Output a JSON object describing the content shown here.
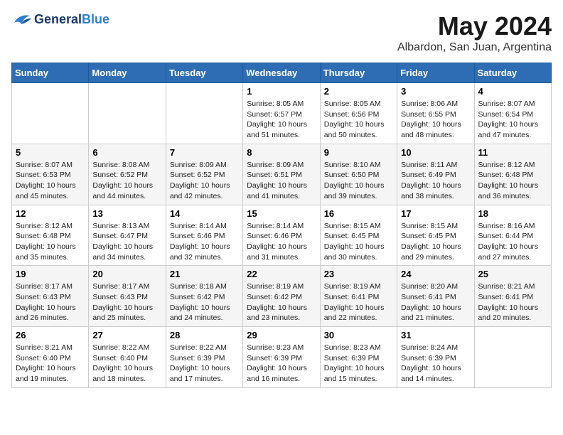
{
  "header": {
    "logo_line1": "General",
    "logo_line2": "Blue",
    "month_title": "May 2024",
    "location": "Albardon, San Juan, Argentina"
  },
  "weekdays": [
    "Sunday",
    "Monday",
    "Tuesday",
    "Wednesday",
    "Thursday",
    "Friday",
    "Saturday"
  ],
  "weeks": [
    [
      {
        "day": "",
        "sunrise": "",
        "sunset": "",
        "daylight": ""
      },
      {
        "day": "",
        "sunrise": "",
        "sunset": "",
        "daylight": ""
      },
      {
        "day": "",
        "sunrise": "",
        "sunset": "",
        "daylight": ""
      },
      {
        "day": "1",
        "sunrise": "Sunrise: 8:05 AM",
        "sunset": "Sunset: 6:57 PM",
        "daylight": "Daylight: 10 hours and 51 minutes."
      },
      {
        "day": "2",
        "sunrise": "Sunrise: 8:05 AM",
        "sunset": "Sunset: 6:56 PM",
        "daylight": "Daylight: 10 hours and 50 minutes."
      },
      {
        "day": "3",
        "sunrise": "Sunrise: 8:06 AM",
        "sunset": "Sunset: 6:55 PM",
        "daylight": "Daylight: 10 hours and 48 minutes."
      },
      {
        "day": "4",
        "sunrise": "Sunrise: 8:07 AM",
        "sunset": "Sunset: 6:54 PM",
        "daylight": "Daylight: 10 hours and 47 minutes."
      }
    ],
    [
      {
        "day": "5",
        "sunrise": "Sunrise: 8:07 AM",
        "sunset": "Sunset: 6:53 PM",
        "daylight": "Daylight: 10 hours and 45 minutes."
      },
      {
        "day": "6",
        "sunrise": "Sunrise: 8:08 AM",
        "sunset": "Sunset: 6:52 PM",
        "daylight": "Daylight: 10 hours and 44 minutes."
      },
      {
        "day": "7",
        "sunrise": "Sunrise: 8:09 AM",
        "sunset": "Sunset: 6:52 PM",
        "daylight": "Daylight: 10 hours and 42 minutes."
      },
      {
        "day": "8",
        "sunrise": "Sunrise: 8:09 AM",
        "sunset": "Sunset: 6:51 PM",
        "daylight": "Daylight: 10 hours and 41 minutes."
      },
      {
        "day": "9",
        "sunrise": "Sunrise: 8:10 AM",
        "sunset": "Sunset: 6:50 PM",
        "daylight": "Daylight: 10 hours and 39 minutes."
      },
      {
        "day": "10",
        "sunrise": "Sunrise: 8:11 AM",
        "sunset": "Sunset: 6:49 PM",
        "daylight": "Daylight: 10 hours and 38 minutes."
      },
      {
        "day": "11",
        "sunrise": "Sunrise: 8:12 AM",
        "sunset": "Sunset: 6:48 PM",
        "daylight": "Daylight: 10 hours and 36 minutes."
      }
    ],
    [
      {
        "day": "12",
        "sunrise": "Sunrise: 8:12 AM",
        "sunset": "Sunset: 6:48 PM",
        "daylight": "Daylight: 10 hours and 35 minutes."
      },
      {
        "day": "13",
        "sunrise": "Sunrise: 8:13 AM",
        "sunset": "Sunset: 6:47 PM",
        "daylight": "Daylight: 10 hours and 34 minutes."
      },
      {
        "day": "14",
        "sunrise": "Sunrise: 8:14 AM",
        "sunset": "Sunset: 6:46 PM",
        "daylight": "Daylight: 10 hours and 32 minutes."
      },
      {
        "day": "15",
        "sunrise": "Sunrise: 8:14 AM",
        "sunset": "Sunset: 6:46 PM",
        "daylight": "Daylight: 10 hours and 31 minutes."
      },
      {
        "day": "16",
        "sunrise": "Sunrise: 8:15 AM",
        "sunset": "Sunset: 6:45 PM",
        "daylight": "Daylight: 10 hours and 30 minutes."
      },
      {
        "day": "17",
        "sunrise": "Sunrise: 8:15 AM",
        "sunset": "Sunset: 6:45 PM",
        "daylight": "Daylight: 10 hours and 29 minutes."
      },
      {
        "day": "18",
        "sunrise": "Sunrise: 8:16 AM",
        "sunset": "Sunset: 6:44 PM",
        "daylight": "Daylight: 10 hours and 27 minutes."
      }
    ],
    [
      {
        "day": "19",
        "sunrise": "Sunrise: 8:17 AM",
        "sunset": "Sunset: 6:43 PM",
        "daylight": "Daylight: 10 hours and 26 minutes."
      },
      {
        "day": "20",
        "sunrise": "Sunrise: 8:17 AM",
        "sunset": "Sunset: 6:43 PM",
        "daylight": "Daylight: 10 hours and 25 minutes."
      },
      {
        "day": "21",
        "sunrise": "Sunrise: 8:18 AM",
        "sunset": "Sunset: 6:42 PM",
        "daylight": "Daylight: 10 hours and 24 minutes."
      },
      {
        "day": "22",
        "sunrise": "Sunrise: 8:19 AM",
        "sunset": "Sunset: 6:42 PM",
        "daylight": "Daylight: 10 hours and 23 minutes."
      },
      {
        "day": "23",
        "sunrise": "Sunrise: 8:19 AM",
        "sunset": "Sunset: 6:41 PM",
        "daylight": "Daylight: 10 hours and 22 minutes."
      },
      {
        "day": "24",
        "sunrise": "Sunrise: 8:20 AM",
        "sunset": "Sunset: 6:41 PM",
        "daylight": "Daylight: 10 hours and 21 minutes."
      },
      {
        "day": "25",
        "sunrise": "Sunrise: 8:21 AM",
        "sunset": "Sunset: 6:41 PM",
        "daylight": "Daylight: 10 hours and 20 minutes."
      }
    ],
    [
      {
        "day": "26",
        "sunrise": "Sunrise: 8:21 AM",
        "sunset": "Sunset: 6:40 PM",
        "daylight": "Daylight: 10 hours and 19 minutes."
      },
      {
        "day": "27",
        "sunrise": "Sunrise: 8:22 AM",
        "sunset": "Sunset: 6:40 PM",
        "daylight": "Daylight: 10 hours and 18 minutes."
      },
      {
        "day": "28",
        "sunrise": "Sunrise: 8:22 AM",
        "sunset": "Sunset: 6:39 PM",
        "daylight": "Daylight: 10 hours and 17 minutes."
      },
      {
        "day": "29",
        "sunrise": "Sunrise: 8:23 AM",
        "sunset": "Sunset: 6:39 PM",
        "daylight": "Daylight: 10 hours and 16 minutes."
      },
      {
        "day": "30",
        "sunrise": "Sunrise: 8:23 AM",
        "sunset": "Sunset: 6:39 PM",
        "daylight": "Daylight: 10 hours and 15 minutes."
      },
      {
        "day": "31",
        "sunrise": "Sunrise: 8:24 AM",
        "sunset": "Sunset: 6:39 PM",
        "daylight": "Daylight: 10 hours and 14 minutes."
      },
      {
        "day": "",
        "sunrise": "",
        "sunset": "",
        "daylight": ""
      }
    ]
  ]
}
